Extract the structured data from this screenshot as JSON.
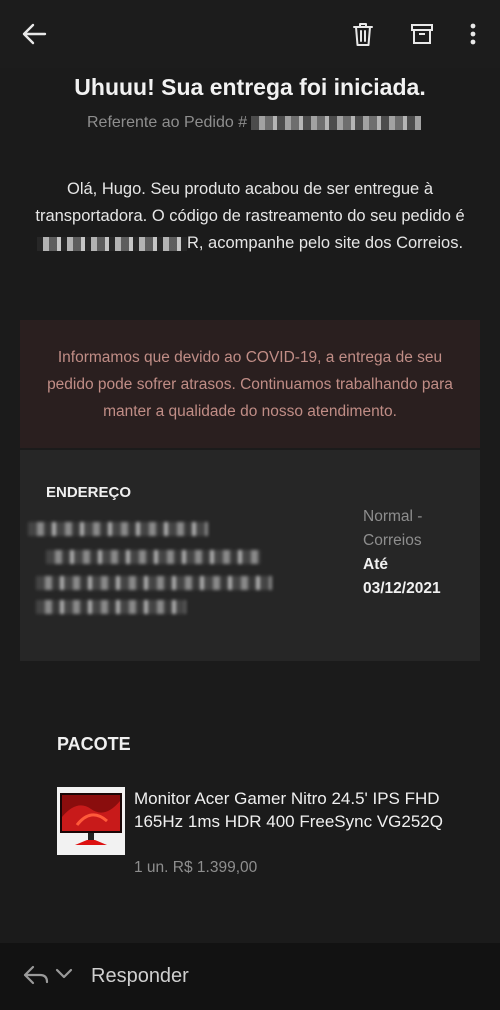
{
  "toolbar": {
    "back_icon": "back-arrow-icon",
    "delete_icon": "trash-icon",
    "archive_icon": "archive-icon",
    "more_icon": "more-vert-icon"
  },
  "email": {
    "title": "Uhuuu! Sua entrega foi iniciada.",
    "order_ref_label": "Referente ao Pedido #",
    "body_line1": "Olá, Hugo. Seu produto acabou de ser entregue à transportadora. O código de rastreamento do seu pedido é",
    "body_line2": "R, acompanhe pelo site dos Correios.",
    "notice": "Informamos que devido ao COVID-19, a entrega de seu pedido pode sofrer atrasos. Continuamos trabalhando para manter a qualidade do nosso atendimento."
  },
  "address": {
    "heading": "ENDEREÇO",
    "shipping_method": "Normal - Correios",
    "eta_label": "Até",
    "eta_date": "03/12/2021"
  },
  "package": {
    "heading": "PACOTE",
    "product_name": "Monitor Acer Gamer Nitro 24.5' IPS FHD 165Hz 1ms HDR 400 FreeSync VG252Q",
    "product_price": "1 un. R$ 1.399,00"
  },
  "reply": {
    "label": "Responder"
  },
  "colors": {
    "background": "#1b1b1b",
    "notice_bg": "#2a1f1f",
    "notice_text": "#c08d86",
    "card_bg": "#262626"
  }
}
